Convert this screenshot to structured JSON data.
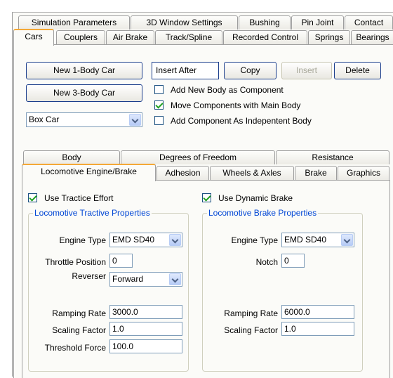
{
  "top_tabs_row1": [
    "Simulation Parameters",
    "3D Window Settings",
    "Bushing",
    "Pin Joint",
    "Contact"
  ],
  "top_tabs_row2": [
    "Cars",
    "Couplers",
    "Air Brake",
    "Track/Spline",
    "Recorded Control",
    "Springs",
    "Bearings"
  ],
  "top_active_tab": "Cars",
  "toolbar": {
    "new_1_body": "New 1-Body Car",
    "new_3_body": "New 3-Body Car",
    "insert_after": "Insert After",
    "copy": "Copy",
    "insert": "Insert",
    "delete": "Delete",
    "car_type": "Box Car"
  },
  "options": {
    "add_new_body": {
      "label": "Add New Body as Component",
      "checked": false
    },
    "move_components": {
      "label": "Move Components with Main Body",
      "checked": true
    },
    "add_independent": {
      "label": "Add Component As Indepentent Body",
      "checked": false
    }
  },
  "sub_tabs_row1": [
    "Body",
    "Degrees of Freedom",
    "Resistance"
  ],
  "sub_tabs_row2": [
    "Locomotive Engine/Brake",
    "Adhesion",
    "Wheels & Axles",
    "Brake",
    "Graphics"
  ],
  "sub_active_tab": "Locomotive Engine/Brake",
  "tractive": {
    "use_label": "Use Tractice Effort",
    "use_checked": true,
    "group_title": "Locomotive Tractive Properties",
    "engine_type_label": "Engine Type",
    "engine_type_value": "EMD SD40",
    "throttle_label": "Throttle Position",
    "throttle_value": "0",
    "reverser_label": "Reverser",
    "reverser_value": "Forward",
    "ramping_label": "Ramping Rate",
    "ramping_value": "3000.0",
    "scaling_label": "Scaling Factor",
    "scaling_value": "1.0",
    "threshold_label": "Threshold Force",
    "threshold_value": "100.0"
  },
  "brake": {
    "use_label": "Use Dynamic Brake",
    "use_checked": true,
    "group_title": "Locomotive Brake Properties",
    "engine_type_label": "Engine Type",
    "engine_type_value": "EMD SD40",
    "notch_label": "Notch",
    "notch_value": "0",
    "ramping_label": "Ramping Rate",
    "ramping_value": "6000.0",
    "scaling_label": "Scaling Factor",
    "scaling_value": "1.0"
  },
  "colors": {
    "accent_tab": "#f4a836",
    "group_title": "#0046d5",
    "check": "#21a121"
  }
}
